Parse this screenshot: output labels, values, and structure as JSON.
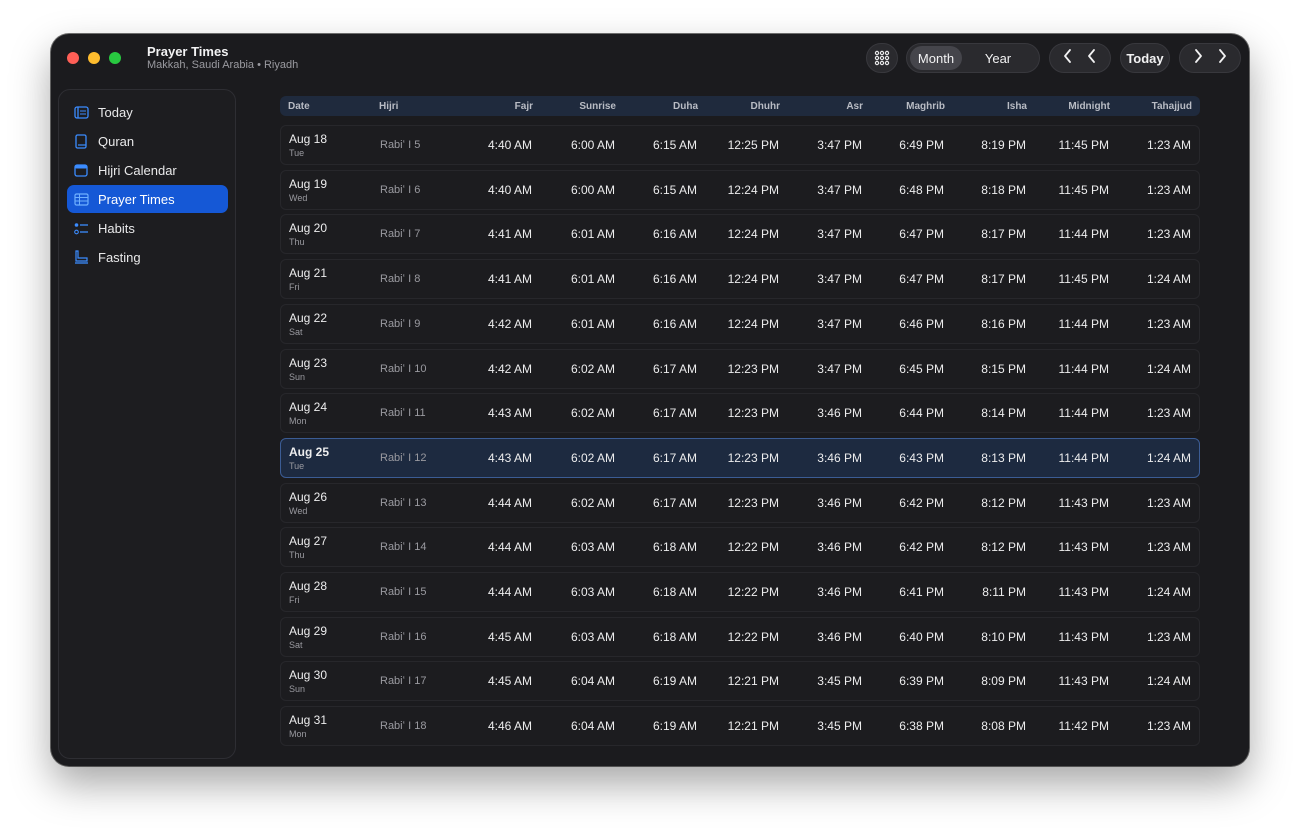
{
  "window": {
    "title": "Prayer Times",
    "subtitle": "Makkah, Saudi Arabia • Riyadh"
  },
  "toolbar": {
    "view_month": "Month",
    "view_year": "Year",
    "today": "Today",
    "icons": [
      "grid-icon",
      "chevron-left-double-icon",
      "chevron-right-double-icon"
    ]
  },
  "sidebar": {
    "items": [
      {
        "label": "Today",
        "icon": "today-icon"
      },
      {
        "label": "Quran",
        "icon": "book-icon"
      },
      {
        "label": "Hijri Calendar",
        "icon": "calendar-icon"
      },
      {
        "label": "Prayer Times",
        "icon": "table-icon",
        "active": true
      },
      {
        "label": "Habits",
        "icon": "list-icon"
      },
      {
        "label": "Fasting",
        "icon": "fasting-icon"
      }
    ],
    "accent": "#1558d6"
  },
  "table": {
    "columns": [
      "Date",
      "Hijri",
      "Fajr",
      "Sunrise",
      "Duha",
      "Dhuhr",
      "Asr",
      "Maghrib",
      "Isha",
      "Midnight",
      "Tahajjud"
    ],
    "rows": [
      {
        "date": "Aug 18",
        "weekday": "Tue",
        "hijri": "Rabiʻ I 5",
        "fajr": "4:40 AM",
        "sunrise": "6:00 AM",
        "duha": "6:15 AM",
        "dhuhr": "12:25 PM",
        "asr": "3:47 PM",
        "maghrib": "6:49 PM",
        "isha": "8:19 PM",
        "midnight": "11:45 PM",
        "tahajjud": "1:23 AM"
      },
      {
        "date": "Aug 19",
        "weekday": "Wed",
        "hijri": "Rabiʻ I 6",
        "fajr": "4:40 AM",
        "sunrise": "6:00 AM",
        "duha": "6:15 AM",
        "dhuhr": "12:24 PM",
        "asr": "3:47 PM",
        "maghrib": "6:48 PM",
        "isha": "8:18 PM",
        "midnight": "11:45 PM",
        "tahajjud": "1:23 AM"
      },
      {
        "date": "Aug 20",
        "weekday": "Thu",
        "hijri": "Rabiʻ I 7",
        "fajr": "4:41 AM",
        "sunrise": "6:01 AM",
        "duha": "6:16 AM",
        "dhuhr": "12:24 PM",
        "asr": "3:47 PM",
        "maghrib": "6:47 PM",
        "isha": "8:17 PM",
        "midnight": "11:44 PM",
        "tahajjud": "1:23 AM"
      },
      {
        "date": "Aug 21",
        "weekday": "Fri",
        "hijri": "Rabiʻ I 8",
        "fajr": "4:41 AM",
        "sunrise": "6:01 AM",
        "duha": "6:16 AM",
        "dhuhr": "12:24 PM",
        "asr": "3:47 PM",
        "maghrib": "6:47 PM",
        "isha": "8:17 PM",
        "midnight": "11:45 PM",
        "tahajjud": "1:24 AM"
      },
      {
        "date": "Aug 22",
        "weekday": "Sat",
        "hijri": "Rabiʻ I 9",
        "fajr": "4:42 AM",
        "sunrise": "6:01 AM",
        "duha": "6:16 AM",
        "dhuhr": "12:24 PM",
        "asr": "3:47 PM",
        "maghrib": "6:46 PM",
        "isha": "8:16 PM",
        "midnight": "11:44 PM",
        "tahajjud": "1:23 AM"
      },
      {
        "date": "Aug 23",
        "weekday": "Sun",
        "hijri": "Rabiʻ I 10",
        "fajr": "4:42 AM",
        "sunrise": "6:02 AM",
        "duha": "6:17 AM",
        "dhuhr": "12:23 PM",
        "asr": "3:47 PM",
        "maghrib": "6:45 PM",
        "isha": "8:15 PM",
        "midnight": "11:44 PM",
        "tahajjud": "1:24 AM"
      },
      {
        "date": "Aug 24",
        "weekday": "Mon",
        "hijri": "Rabiʻ I 11",
        "fajr": "4:43 AM",
        "sunrise": "6:02 AM",
        "duha": "6:17 AM",
        "dhuhr": "12:23 PM",
        "asr": "3:46 PM",
        "maghrib": "6:44 PM",
        "isha": "8:14 PM",
        "midnight": "11:44 PM",
        "tahajjud": "1:23 AM"
      },
      {
        "date": "Aug 25",
        "weekday": "Tue",
        "hijri": "Rabiʻ I 12",
        "fajr": "4:43 AM",
        "sunrise": "6:02 AM",
        "duha": "6:17 AM",
        "dhuhr": "12:23 PM",
        "asr": "3:46 PM",
        "maghrib": "6:43 PM",
        "isha": "8:13 PM",
        "midnight": "11:44 PM",
        "tahajjud": "1:24 AM",
        "today": true
      },
      {
        "date": "Aug 26",
        "weekday": "Wed",
        "hijri": "Rabiʻ I 13",
        "fajr": "4:44 AM",
        "sunrise": "6:02 AM",
        "duha": "6:17 AM",
        "dhuhr": "12:23 PM",
        "asr": "3:46 PM",
        "maghrib": "6:42 PM",
        "isha": "8:12 PM",
        "midnight": "11:43 PM",
        "tahajjud": "1:23 AM"
      },
      {
        "date": "Aug 27",
        "weekday": "Thu",
        "hijri": "Rabiʻ I 14",
        "fajr": "4:44 AM",
        "sunrise": "6:03 AM",
        "duha": "6:18 AM",
        "dhuhr": "12:22 PM",
        "asr": "3:46 PM",
        "maghrib": "6:42 PM",
        "isha": "8:12 PM",
        "midnight": "11:43 PM",
        "tahajjud": "1:23 AM"
      },
      {
        "date": "Aug 28",
        "weekday": "Fri",
        "hijri": "Rabiʻ I 15",
        "fajr": "4:44 AM",
        "sunrise": "6:03 AM",
        "duha": "6:18 AM",
        "dhuhr": "12:22 PM",
        "asr": "3:46 PM",
        "maghrib": "6:41 PM",
        "isha": "8:11 PM",
        "midnight": "11:43 PM",
        "tahajjud": "1:24 AM"
      },
      {
        "date": "Aug 29",
        "weekday": "Sat",
        "hijri": "Rabiʻ I 16",
        "fajr": "4:45 AM",
        "sunrise": "6:03 AM",
        "duha": "6:18 AM",
        "dhuhr": "12:22 PM",
        "asr": "3:46 PM",
        "maghrib": "6:40 PM",
        "isha": "8:10 PM",
        "midnight": "11:43 PM",
        "tahajjud": "1:23 AM"
      },
      {
        "date": "Aug 30",
        "weekday": "Sun",
        "hijri": "Rabiʻ I 17",
        "fajr": "4:45 AM",
        "sunrise": "6:04 AM",
        "duha": "6:19 AM",
        "dhuhr": "12:21 PM",
        "asr": "3:45 PM",
        "maghrib": "6:39 PM",
        "isha": "8:09 PM",
        "midnight": "11:43 PM",
        "tahajjud": "1:24 AM"
      },
      {
        "date": "Aug 31",
        "weekday": "Mon",
        "hijri": "Rabiʻ I 18",
        "fajr": "4:46 AM",
        "sunrise": "6:04 AM",
        "duha": "6:19 AM",
        "dhuhr": "12:21 PM",
        "asr": "3:45 PM",
        "maghrib": "6:38 PM",
        "isha": "8:08 PM",
        "midnight": "11:42 PM",
        "tahajjud": "1:23 AM"
      }
    ]
  },
  "colors": {
    "window_bg": "#1b1b1e",
    "header_bg": "#1f2a3d",
    "highlight_bg": "#1d2a40",
    "highlight_border": "#3b5c94"
  }
}
